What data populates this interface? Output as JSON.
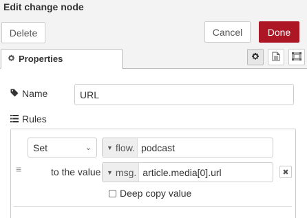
{
  "dialog": {
    "title": "Edit change node"
  },
  "toolbar": {
    "delete_label": "Delete",
    "cancel_label": "Cancel",
    "done_label": "Done"
  },
  "tabs": {
    "properties_label": "Properties",
    "icons": [
      "gear-icon",
      "file-text-icon",
      "appearance-icon"
    ]
  },
  "form": {
    "name_label": "Name",
    "name_value": "URL",
    "rules_label": "Rules"
  },
  "rule": {
    "action": "Set",
    "set_type": "flow.",
    "set_value": "podcast",
    "to_label": "to the value",
    "to_type": "msg.",
    "to_value": "article.media[0].url",
    "deep_copy_label": "Deep copy value",
    "deep_copy_checked": false
  },
  "colors": {
    "done_button": "#ad1625",
    "panel_bg": "#f3f3f3"
  }
}
